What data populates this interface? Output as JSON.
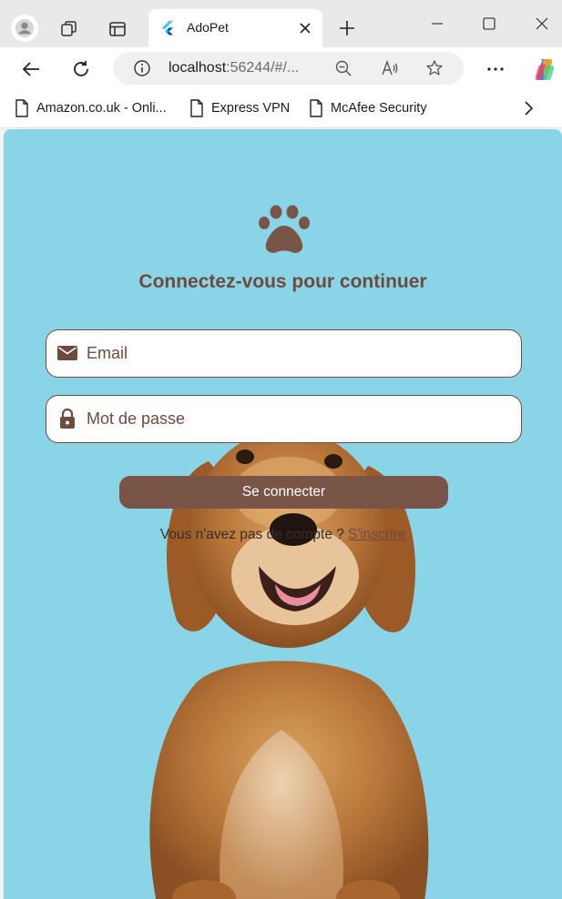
{
  "browser": {
    "tab_title": "AdoPet",
    "url_host": "localhost",
    "url_rest": ":56244/#/...",
    "bookmarks": [
      {
        "label": "Amazon.co.uk - Onli..."
      },
      {
        "label": "Express VPN"
      },
      {
        "label": "McAfee Security"
      }
    ]
  },
  "login": {
    "headline": "Connectez-vous pour continuer",
    "email_placeholder": "Email",
    "password_placeholder": "Mot de passe",
    "submit_label": "Se connecter",
    "no_account_text": "Vous n'avez pas de compte ?",
    "signup_label": "S'inscrire"
  },
  "colors": {
    "page_background": "#89d4e6",
    "brand_brown": "#6e4b3e",
    "button_brown": "#795548"
  },
  "icons": {
    "email": "envelope-icon",
    "password": "lock-icon",
    "logo": "paw-icon"
  }
}
